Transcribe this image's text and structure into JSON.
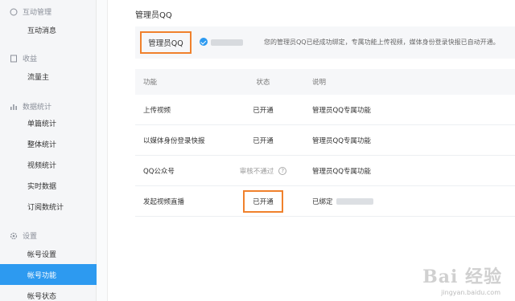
{
  "sidebar": {
    "groups": [
      {
        "title": "互动管理",
        "icon": "chat-bubble-icon",
        "items": [
          "互动消息"
        ]
      },
      {
        "title": "收益",
        "icon": "bookmark-icon",
        "items": [
          "流量主"
        ]
      },
      {
        "title": "数据统计",
        "icon": "bar-chart-icon",
        "items": [
          "单篇统计",
          "整体统计",
          "视频统计",
          "实时数据",
          "订阅数统计"
        ]
      },
      {
        "title": "设置",
        "icon": "gear-icon",
        "items": [
          "帐号设置",
          "帐号功能",
          "帐号状态"
        ]
      }
    ],
    "active_item": "帐号功能"
  },
  "main": {
    "title": "管理员QQ",
    "admin": {
      "label": "管理员QQ",
      "description": "您的管理员QQ已经成功绑定，专属功能上传视频，媒体身份登录快报已自动开通。"
    },
    "table": {
      "headers": [
        "功能",
        "状态",
        "说明"
      ],
      "rows": [
        {
          "feature": "上传视频",
          "status": "已开通",
          "note": "管理员QQ专属功能"
        },
        {
          "feature": "以媒体身份登录快报",
          "status": "已开通",
          "note": "管理员QQ专属功能"
        },
        {
          "feature": "QQ公众号",
          "status": "审核不通过",
          "note": "管理员QQ专属功能"
        },
        {
          "feature": "发起视频直播",
          "status": "已开通",
          "note": "已绑定"
        }
      ]
    }
  },
  "watermark": {
    "text": "Bai 经验",
    "url": "jingyan.baidu.com"
  },
  "colors": {
    "accent": "#2d9af0",
    "highlight": "#f0812c",
    "sidebar_bg": "#f5f6f8"
  }
}
